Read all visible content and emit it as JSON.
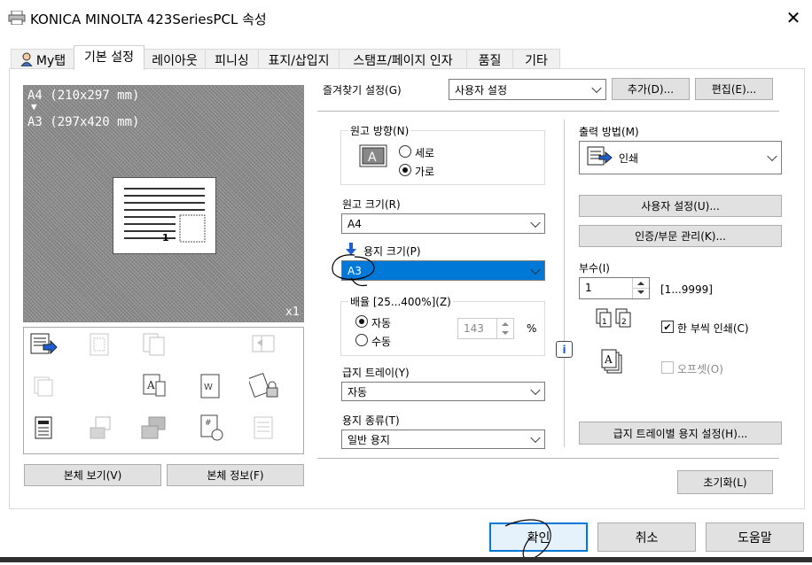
{
  "window": {
    "title": "KONICA MINOLTA 423SeriesPCL 속성"
  },
  "tabs": [
    {
      "label": "My탭"
    },
    {
      "label": "기본 설정"
    },
    {
      "label": "레이아웃"
    },
    {
      "label": "피니싱"
    },
    {
      "label": "표지/삽입지"
    },
    {
      "label": "스탬프/페이지 인자"
    },
    {
      "label": "품질"
    },
    {
      "label": "기타"
    }
  ],
  "preview": {
    "line1": "A4 (210x297 mm)",
    "arrow": "▼",
    "line2": "A3 (297x420 mm)",
    "copies": "x1",
    "page_num": "1"
  },
  "left_buttons": {
    "view": "본체 보기(V)",
    "info": "본체 정보(F)"
  },
  "favorites": {
    "label": "즐겨찾기 설정(G)",
    "value": "사용자 설정",
    "add": "추가(D)...",
    "edit": "편집(E)..."
  },
  "orientation": {
    "label": "원고 방향(N)",
    "portrait": "세로",
    "landscape": "가로",
    "selected": "landscape"
  },
  "original_size": {
    "label": "원고 크기(R)",
    "value": "A4"
  },
  "paper_size": {
    "label": "용지 크기(P)",
    "value": "A3"
  },
  "zoom": {
    "label": "배율 [25...400%](Z)",
    "auto": "자동",
    "manual": "수동",
    "value": "143",
    "unit": "%"
  },
  "paper_tray": {
    "label": "급지 트레이(Y)",
    "value": "자동"
  },
  "paper_type": {
    "label": "용지 종류(T)",
    "value": "일반 용지"
  },
  "output": {
    "label": "출력 방법(M)",
    "value": "인쇄",
    "user_settings": "사용자 설정(U)...",
    "auth": "인증/부문 관리(K)..."
  },
  "copies": {
    "label": "부수(I)",
    "value": "1",
    "range": "[1...9999]",
    "collate": "한 부씩 인쇄(C)",
    "offset": "오프셋(O)"
  },
  "tray_settings": "급지 트레이별 용지 설정(H)...",
  "reset": "초기화(L)",
  "footer": {
    "ok": "확인",
    "cancel": "취소",
    "help": "도움말"
  },
  "colors": {
    "accent": "#0078d7",
    "ok_border": "#0078d7",
    "ok_bg": "#e5f1fb"
  }
}
